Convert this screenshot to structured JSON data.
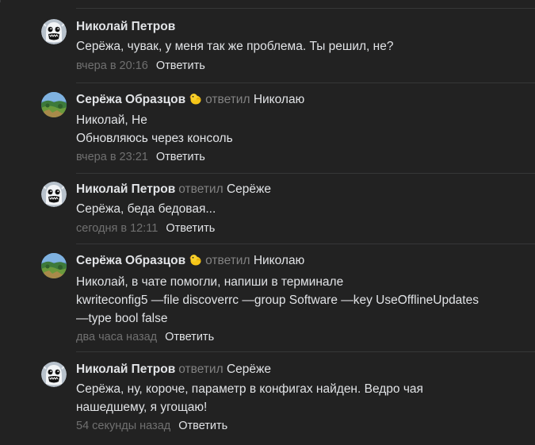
{
  "reply_label": "Ответить",
  "replied_label": "ответил",
  "comments": [
    {
      "author": "Николай Петров",
      "replied_to": "",
      "lines": [
        "Серёжа, чувак, у меня так же проблема. Ты решил, не?"
      ],
      "date": "вчера в 20:16",
      "avatar": "ghost-face-avatar"
    },
    {
      "author": "Серёжа Образцов",
      "replied_to": "Николаю",
      "lines": [
        "Николай, Не",
        "Обновляюсь через консоль"
      ],
      "date": "вчера в 23:21",
      "avatar": "landscape-avatar"
    },
    {
      "author": "Николай Петров",
      "replied_to": "Серёже",
      "lines": [
        "Серёжа, беда бедовая..."
      ],
      "date": "сегодня в 12:11",
      "avatar": "ghost-face-avatar"
    },
    {
      "author": "Серёжа Образцов",
      "replied_to": "Николаю",
      "lines": [
        "Николай, в чате помогли, напиши в терминале",
        "kwriteconfig5 —file discoverrc —group Software —key UseOfflineUpdates",
        "—type bool false"
      ],
      "date": "два часа назад",
      "avatar": "landscape-avatar"
    },
    {
      "author": "Николай Петров",
      "replied_to": "Серёже",
      "lines": [
        "Серёжа, ну, короче, параметр в конфигах найден. Ведро чая",
        "нашедшему, я угощаю!"
      ],
      "date": "54 секунды назад",
      "avatar": "ghost-face-avatar"
    }
  ],
  "colors": {
    "background": "#222222",
    "text": "#e1e3e6",
    "secondary": "#828282",
    "date": "#707070",
    "separator": "#363738"
  },
  "icons": {
    "author_badge": "chick-emoji-icon"
  }
}
